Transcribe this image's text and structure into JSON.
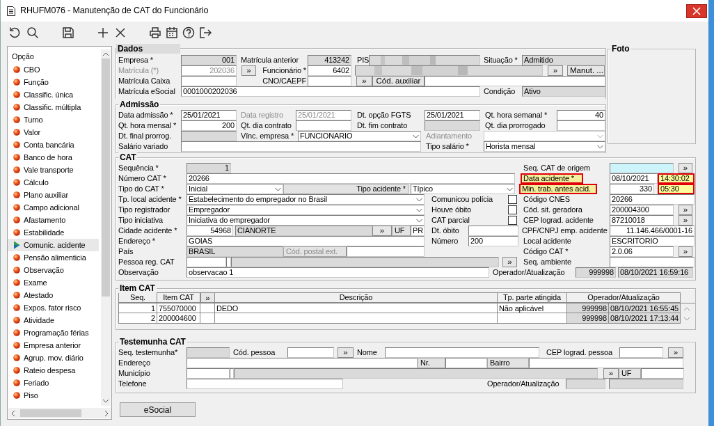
{
  "window": {
    "title": "RHUFM076 - Manutenção de CAT do Funcionário"
  },
  "sidebar": {
    "header": "Opção",
    "items": [
      {
        "label": "CBO",
        "selected": false
      },
      {
        "label": "Função",
        "selected": false
      },
      {
        "label": "Classific. única",
        "selected": false
      },
      {
        "label": "Classific. múltipla",
        "selected": false
      },
      {
        "label": "Turno",
        "selected": false
      },
      {
        "label": "Valor",
        "selected": false
      },
      {
        "label": "Conta bancária",
        "selected": false
      },
      {
        "label": "Banco de hora",
        "selected": false
      },
      {
        "label": "Vale transporte",
        "selected": false
      },
      {
        "label": "Cálculo",
        "selected": false
      },
      {
        "label": "Plano auxiliar",
        "selected": false
      },
      {
        "label": "Campo adicional",
        "selected": false
      },
      {
        "label": "Afastamento",
        "selected": false
      },
      {
        "label": "Estabilidade",
        "selected": false
      },
      {
        "label": "Comunic. acidente",
        "selected": true
      },
      {
        "label": "Pensão alimenticia",
        "selected": false
      },
      {
        "label": "Observação",
        "selected": false
      },
      {
        "label": "Exame",
        "selected": false
      },
      {
        "label": "Atestado",
        "selected": false
      },
      {
        "label": "Expos. fator risco",
        "selected": false
      },
      {
        "label": "Atividade",
        "selected": false
      },
      {
        "label": "Programação férias",
        "selected": false
      },
      {
        "label": "Empresa anterior",
        "selected": false
      },
      {
        "label": "Agrup. mov. diário",
        "selected": false
      },
      {
        "label": "Rateio despesa",
        "selected": false
      },
      {
        "label": "Feriado",
        "selected": false
      },
      {
        "label": "Piso",
        "selected": false
      }
    ]
  },
  "dados": {
    "legend": "Dados",
    "lines": [
      {
        "items": [
          {
            "kind": "label",
            "text": "Empresa *"
          },
          {
            "kind": "field_grey",
            "text": "001"
          },
          {
            "kind": "label",
            "text": "Matrícula anterior"
          },
          {
            "kind": "field_grey",
            "text": "413242"
          },
          {
            "kind": "label",
            "text": "PIS"
          },
          {
            "kind": "redacted"
          },
          {
            "kind": "label",
            "text": "Situação *"
          },
          {
            "kind": "field_grey",
            "text": "Admitido"
          }
        ]
      },
      {
        "items": [
          {
            "kind": "label_dim",
            "text": "Matrícula (*)"
          },
          {
            "kind": "field_dim",
            "text": "202036"
          },
          {
            "kind": "button",
            "text": "»"
          },
          {
            "kind": "label",
            "text": "Funcionário *"
          },
          {
            "kind": "field",
            "text": "6402"
          },
          {
            "kind": "redacted"
          },
          {
            "kind": "button",
            "text": "»"
          },
          {
            "kind": "button",
            "text": "Manut. ..."
          }
        ]
      },
      {
        "items": [
          {
            "kind": "label",
            "text": "Matrícula Caixa"
          },
          {
            "kind": "field"
          },
          {
            "kind": "label",
            "text": "CNO/CAEPF"
          },
          {
            "kind": "field"
          },
          {
            "kind": "button",
            "text": "»"
          },
          {
            "kind": "button",
            "text": "Cód. auxiliar"
          },
          {
            "kind": "field"
          }
        ]
      },
      {
        "items": [
          {
            "kind": "label",
            "text": "Matrícula eSocial"
          },
          {
            "kind": "field",
            "text": "0001000202036"
          },
          {
            "kind": "label",
            "text": "Condição"
          },
          {
            "kind": "field_grey",
            "text": "Ativo"
          }
        ]
      }
    ]
  },
  "admissao": {
    "legend": "Admissão",
    "lines": [
      {
        "items": [
          {
            "kind": "label",
            "text": "Data admissão *"
          },
          {
            "kind": "field",
            "text": "25/01/2021"
          },
          {
            "kind": "label_dim",
            "text": "Data registro"
          },
          {
            "kind": "field_dim",
            "text": "25/01/2021"
          },
          {
            "kind": "label",
            "text": "Dt. opção FGTS"
          },
          {
            "kind": "field",
            "text": "25/01/2021"
          },
          {
            "kind": "label",
            "text": "Qt. hora semanal *"
          },
          {
            "kind": "field",
            "text": "40"
          }
        ]
      },
      {
        "items": [
          {
            "kind": "label",
            "text": "Qt. hora mensal *"
          },
          {
            "kind": "field",
            "text": "200"
          },
          {
            "kind": "label",
            "text": "Qt. dia contrato"
          },
          {
            "kind": "field"
          },
          {
            "kind": "label",
            "text": "Dt. fim contrato"
          },
          {
            "kind": "field_grey"
          },
          {
            "kind": "label",
            "text": "Qt. dia prorrogado"
          },
          {
            "kind": "field"
          }
        ]
      },
      {
        "items": [
          {
            "kind": "label",
            "text": "Dt. final prorrog."
          },
          {
            "kind": "field_grey"
          },
          {
            "kind": "label",
            "text": "Vínc. empresa *"
          },
          {
            "kind": "select",
            "text": "FUNCIONARIO"
          },
          {
            "kind": "label_dim",
            "text": "Adiantamento"
          },
          {
            "kind": "select_dim"
          }
        ]
      },
      {
        "items": [
          {
            "kind": "label",
            "text": "Salário variado"
          },
          {
            "kind": "field"
          },
          {
            "kind": "label",
            "text": "Tipo salário *"
          },
          {
            "kind": "select",
            "text": "Horista mensal"
          }
        ]
      }
    ]
  },
  "foto": {
    "legend": "Foto"
  },
  "cat": {
    "legend": "CAT",
    "lines": [
      {
        "items": [
          {
            "kind": "label",
            "text": "Sequência *"
          },
          {
            "kind": "field_grey",
            "text": "1"
          },
          {
            "kind": "label",
            "text": "Seq. CAT de origem"
          },
          {
            "kind": "field_cyan"
          },
          {
            "kind": "button",
            "text": "»"
          }
        ]
      },
      {
        "items": [
          {
            "kind": "label",
            "text": "Número CAT *"
          },
          {
            "kind": "field",
            "text": "20266"
          },
          {
            "kind": "label_alert",
            "text": "Data acidente *"
          },
          {
            "kind": "field",
            "text": "08/10/2021"
          },
          {
            "kind": "field_alert",
            "text": "14:30:02"
          }
        ]
      },
      {
        "items": [
          {
            "kind": "label",
            "text": "Tipo do CAT *"
          },
          {
            "kind": "select",
            "text": "Inicial"
          },
          {
            "kind": "tag",
            "text": "Tipo acidente *"
          },
          {
            "kind": "select",
            "text": "Típico"
          },
          {
            "kind": "label_alert",
            "text": "Min. trab. antes acid."
          },
          {
            "kind": "field",
            "text": "330"
          },
          {
            "kind": "field_alert",
            "text": "05:30"
          }
        ]
      },
      {
        "items": [
          {
            "kind": "label",
            "text": "Tp. local acidente *"
          },
          {
            "kind": "select",
            "text": "Estabelecimento do empregador no Brasil"
          },
          {
            "kind": "label",
            "text": "Comunicou polícia"
          },
          {
            "kind": "check",
            "checked": false
          },
          {
            "kind": "label",
            "text": "Código CNES"
          },
          {
            "kind": "field",
            "text": "20266"
          }
        ]
      },
      {
        "items": [
          {
            "kind": "label",
            "text": "Tipo registrador"
          },
          {
            "kind": "select",
            "text": "Empregador"
          },
          {
            "kind": "label",
            "text": "Houve óbito"
          },
          {
            "kind": "check",
            "checked": false
          },
          {
            "kind": "label",
            "text": "Cód. sit. geradora"
          },
          {
            "kind": "field",
            "text": "200004300"
          },
          {
            "kind": "button",
            "text": "»"
          }
        ]
      },
      {
        "items": [
          {
            "kind": "label",
            "text": "Tipo iniciativa"
          },
          {
            "kind": "select",
            "text": "Iniciativa do empregador"
          },
          {
            "kind": "label",
            "text": "CAT parcial"
          },
          {
            "kind": "check",
            "checked": false
          },
          {
            "kind": "label",
            "text": "CEP lograd. acidente"
          },
          {
            "kind": "field",
            "text": "87210018"
          },
          {
            "kind": "button",
            "text": "»"
          }
        ]
      },
      {
        "items": [
          {
            "kind": "label",
            "text": "Cidade acidente *"
          },
          {
            "kind": "field",
            "text": "54968"
          },
          {
            "kind": "field_grey",
            "text": "CIANORTE"
          },
          {
            "kind": "button",
            "text": "»"
          },
          {
            "kind": "tag",
            "text": "UF"
          },
          {
            "kind": "field",
            "text": "PR"
          },
          {
            "kind": "label",
            "text": "Dt. óbito"
          },
          {
            "kind": "field"
          },
          {
            "kind": "label",
            "text": "CPF/CNPJ emp. acidente"
          },
          {
            "kind": "field",
            "text": "11.146.466/0001-16"
          }
        ]
      },
      {
        "items": [
          {
            "kind": "label",
            "text": "Endereço *"
          },
          {
            "kind": "field",
            "text": "GOIAS"
          },
          {
            "kind": "label",
            "text": "Número"
          },
          {
            "kind": "field",
            "text": "200"
          },
          {
            "kind": "label",
            "text": "Local acidente"
          },
          {
            "kind": "field",
            "text": "ESCRITORIO"
          }
        ]
      },
      {
        "items": [
          {
            "kind": "label",
            "text": "País"
          },
          {
            "kind": "field_grey",
            "text": "BRASIL"
          },
          {
            "kind": "tag_dim",
            "text": "Cód. postal ext."
          },
          {
            "kind": "field"
          },
          {
            "kind": "label",
            "text": "Código CAT *"
          },
          {
            "kind": "field",
            "text": "2.0.06"
          },
          {
            "kind": "button",
            "text": "»"
          }
        ]
      },
      {
        "items": [
          {
            "kind": "label",
            "text": "Pessoa reg. CAT"
          },
          {
            "kind": "field"
          },
          {
            "kind": "field"
          },
          {
            "kind": "field_grey"
          },
          {
            "kind": "button",
            "text": "»"
          },
          {
            "kind": "label",
            "text": "Seq. ambiente"
          },
          {
            "kind": "field"
          }
        ]
      },
      {
        "items": [
          {
            "kind": "label",
            "text": "Observação"
          },
          {
            "kind": "field",
            "text": "observacao 1"
          },
          {
            "kind": "label",
            "text": "Operador/Atualização"
          },
          {
            "kind": "field_grey",
            "text": "999998"
          },
          {
            "kind": "field_grey",
            "text": "08/10/2021 16:59:16"
          }
        ]
      }
    ]
  },
  "item_cat": {
    "legend": "Item CAT",
    "columns": [
      "Seq.",
      "Item CAT",
      "»",
      "Descrição",
      "Tp. parte atingida",
      "Operador/Atualização"
    ],
    "rows": [
      {
        "seq": "1",
        "item_cat": "755070000",
        "descricao": "DEDO",
        "tp_parte": "Não aplicável",
        "operador": "999998",
        "atualizacao": "08/10/2021 16:55:45"
      },
      {
        "seq": "2",
        "item_cat": "200004600",
        "operador": "999998",
        "atualizacao": "08/10/2021 17:13:44"
      }
    ]
  },
  "testemunha": {
    "legend": "Testemunha CAT",
    "lines": [
      {
        "items": [
          {
            "kind": "label",
            "text": "Seq. testemunha*"
          },
          {
            "kind": "field_grey"
          },
          {
            "kind": "label",
            "text": "Cód. pessoa"
          },
          {
            "kind": "field"
          },
          {
            "kind": "button",
            "text": "»"
          },
          {
            "kind": "label",
            "text": "Nome"
          },
          {
            "kind": "field"
          },
          {
            "kind": "label",
            "text": "CEP lograd. pessoa"
          },
          {
            "kind": "field"
          },
          {
            "kind": "button",
            "text": "»"
          }
        ]
      },
      {
        "items": [
          {
            "kind": "label",
            "text": "Endereço"
          },
          {
            "kind": "field"
          },
          {
            "kind": "tag",
            "text": "Nr."
          },
          {
            "kind": "field"
          },
          {
            "kind": "tag",
            "text": "Bairro"
          },
          {
            "kind": "field"
          }
        ]
      },
      {
        "items": [
          {
            "kind": "label",
            "text": "Município"
          },
          {
            "kind": "field"
          },
          {
            "kind": "field"
          },
          {
            "kind": "field_grey"
          },
          {
            "kind": "button",
            "text": "»"
          },
          {
            "kind": "tag",
            "text": "UF"
          },
          {
            "kind": "field"
          }
        ]
      },
      {
        "items": [
          {
            "kind": "label",
            "text": "Telefone"
          },
          {
            "kind": "field"
          },
          {
            "kind": "label",
            "text": "Operador/Atualização"
          },
          {
            "kind": "field_grey"
          },
          {
            "kind": "field_grey"
          }
        ]
      }
    ]
  },
  "esocial_button": "eSocial"
}
